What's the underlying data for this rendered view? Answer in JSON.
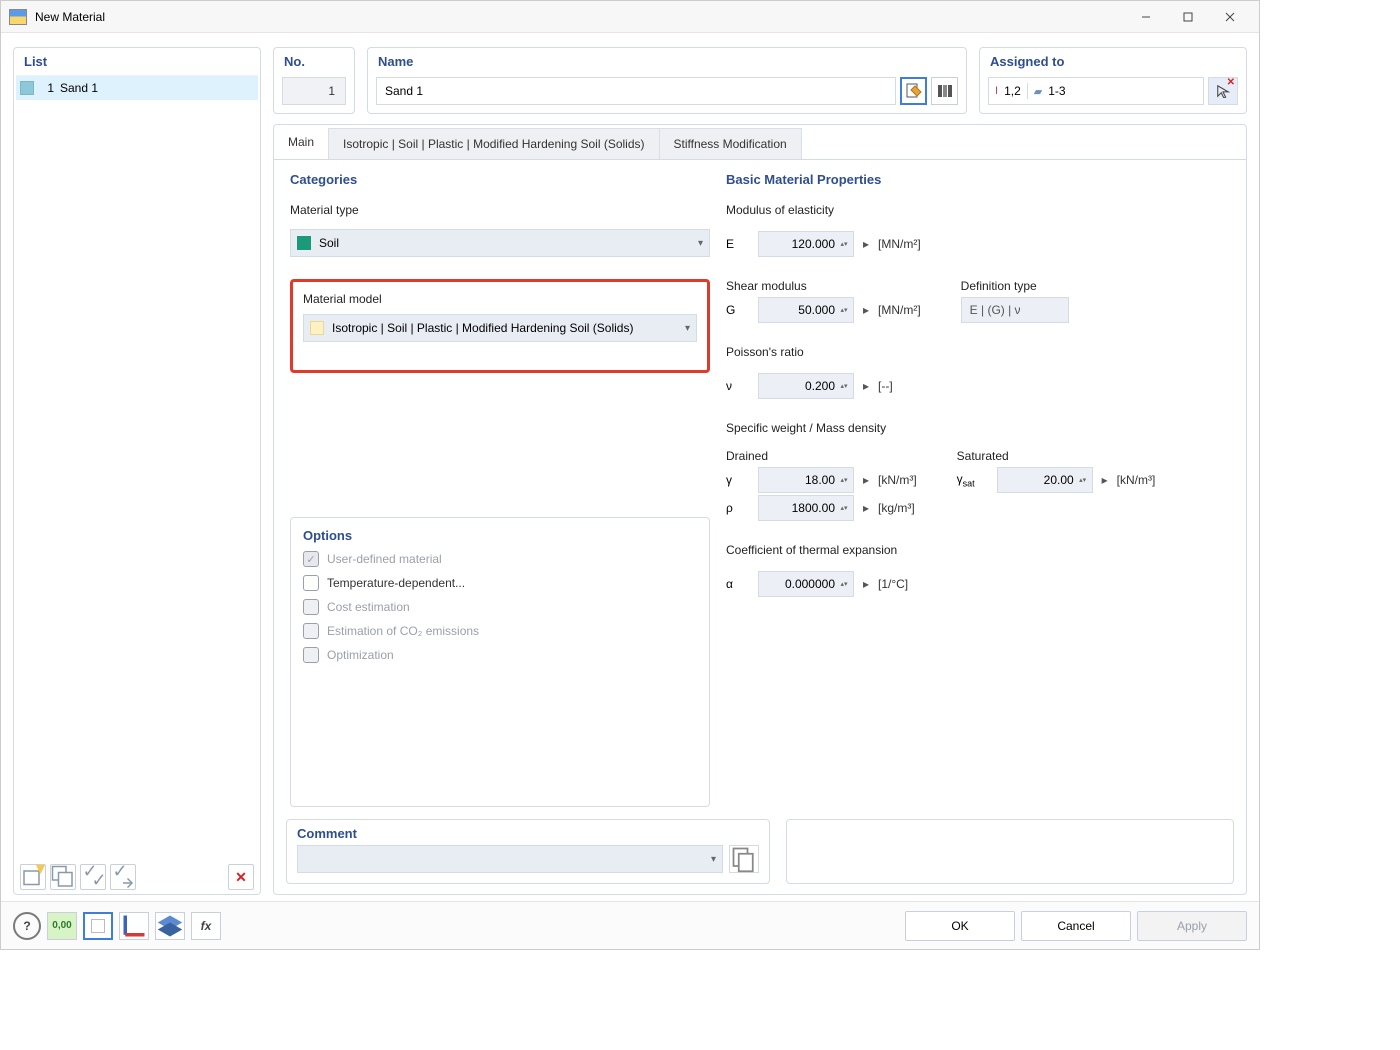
{
  "window": {
    "title": "New Material"
  },
  "list": {
    "title": "List",
    "items": [
      {
        "num": "1",
        "name": "Sand 1"
      }
    ]
  },
  "header": {
    "no_label": "No.",
    "no_value": "1",
    "name_label": "Name",
    "name_value": "Sand 1",
    "assigned_label": "Assigned to",
    "assigned_a": "1,2",
    "assigned_b": "1-3"
  },
  "tabs": {
    "main": "Main",
    "iso": "Isotropic | Soil | Plastic | Modified Hardening Soil (Solids)",
    "stiff": "Stiffness Modification"
  },
  "categories": {
    "title": "Categories",
    "material_type_label": "Material type",
    "material_type_value": "Soil",
    "material_model_label": "Material model",
    "material_model_value": "Isotropic | Soil | Plastic | Modified Hardening Soil (Solids)"
  },
  "options": {
    "title": "Options",
    "user_defined": "User-defined material",
    "temp_dep": "Temperature-dependent...",
    "cost": "Cost estimation",
    "co2": "Estimation of CO₂ emissions",
    "optim": "Optimization"
  },
  "props": {
    "title": "Basic Material Properties",
    "E_label": "Modulus of elasticity",
    "E_sym": "E",
    "E_val": "120.000",
    "E_unit": "[MN/m²]",
    "G_label": "Shear modulus",
    "G_sym": "G",
    "G_val": "50.000",
    "G_unit": "[MN/m²]",
    "deftype_label": "Definition type",
    "deftype_val": "E | (G) | ν",
    "nu_label": "Poisson's ratio",
    "nu_sym": "ν",
    "nu_val": "0.200",
    "nu_unit": "[--]",
    "weight_label": "Specific weight / Mass density",
    "drained": "Drained",
    "saturated": "Saturated",
    "gamma_sym": "γ",
    "gamma_val": "18.00",
    "gamma_unit": "[kN/m³]",
    "gamma_sat_sym": "γsat",
    "gamma_sat_val": "20.00",
    "gamma_sat_unit": "[kN/m³]",
    "rho_sym": "ρ",
    "rho_val": "1800.00",
    "rho_unit": "[kg/m³]",
    "alpha_label": "Coefficient of thermal expansion",
    "alpha_sym": "α",
    "alpha_val": "0.000000",
    "alpha_unit": "[1/°C]"
  },
  "comment": {
    "title": "Comment"
  },
  "buttons": {
    "ok": "OK",
    "cancel": "Cancel",
    "apply": "Apply"
  }
}
